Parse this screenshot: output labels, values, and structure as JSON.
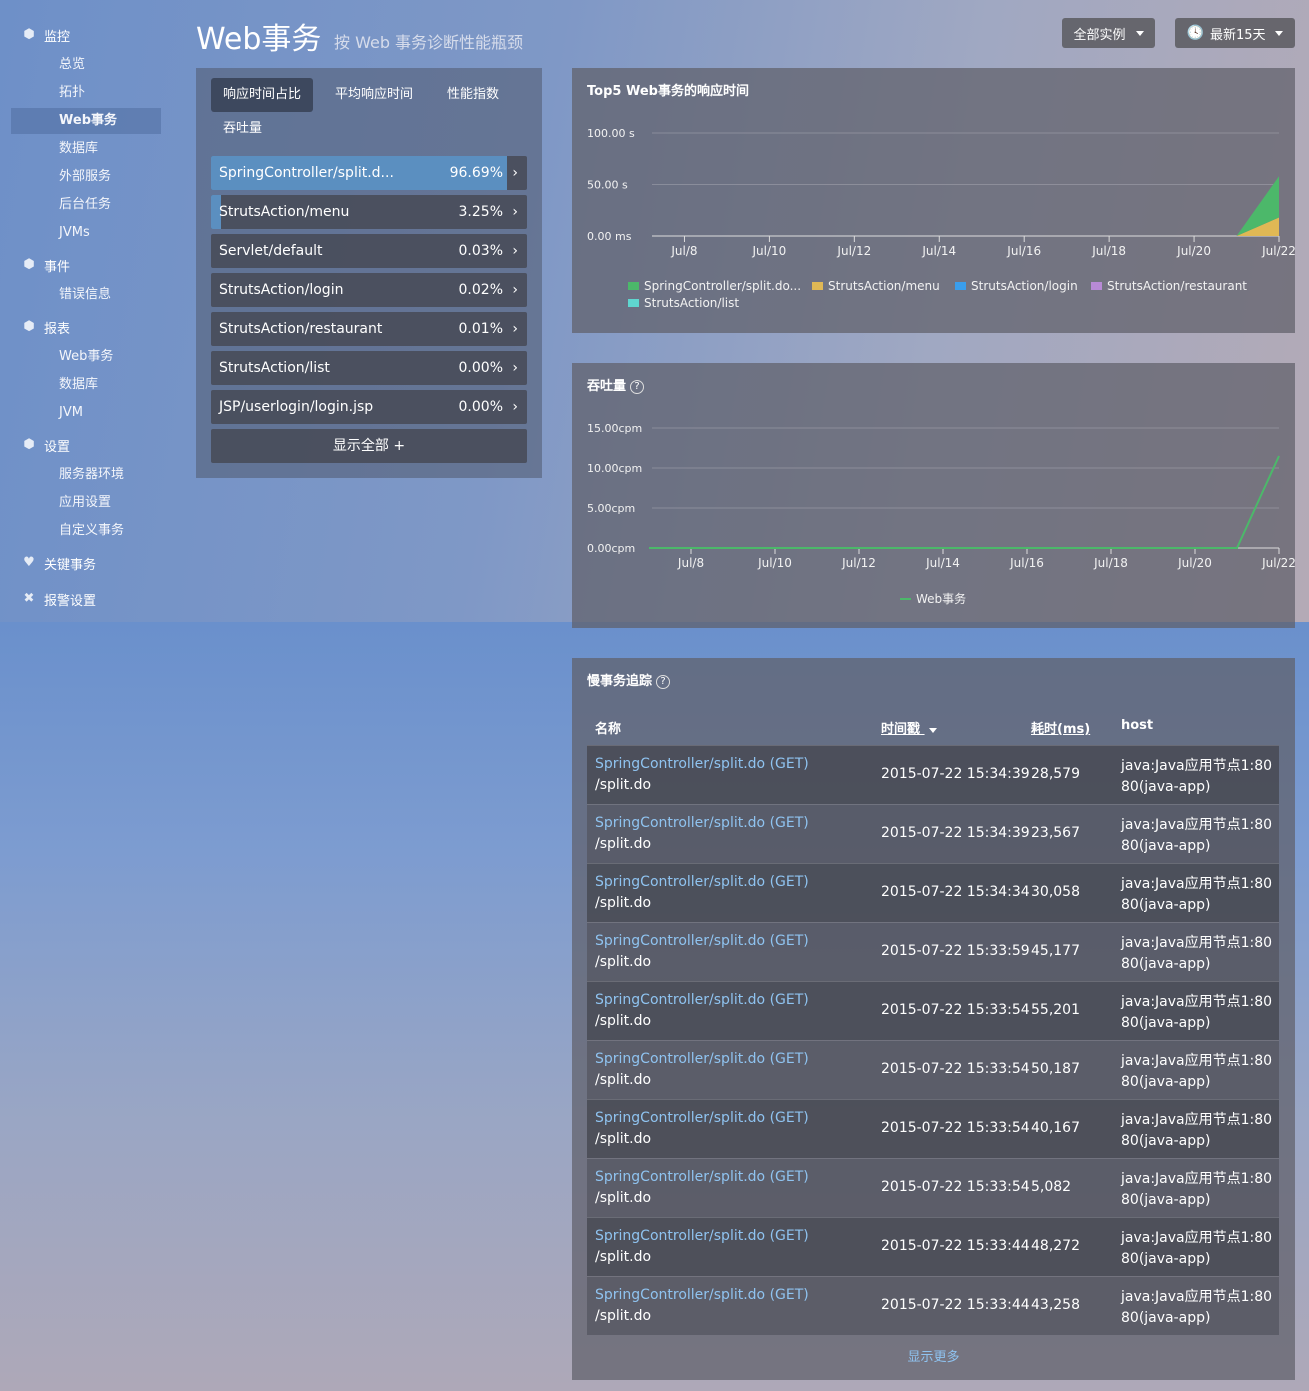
{
  "sidebar": {
    "monitor": {
      "label": "监控",
      "icon": "cube-icon",
      "items": [
        "总览",
        "拓扑",
        "Web事务",
        "数据库",
        "外部服务",
        "后台任务",
        "JVMs"
      ]
    },
    "events": {
      "label": "事件",
      "icon": "cube-icon",
      "items": [
        "错误信息"
      ]
    },
    "reports": {
      "label": "报表",
      "icon": "cube-icon",
      "items": [
        "Web事务",
        "数据库",
        "JVM"
      ]
    },
    "settings": {
      "label": "设置",
      "icon": "cube-icon",
      "items": [
        "服务器环境",
        "应用设置",
        "自定义事务"
      ]
    },
    "key_tx": {
      "label": "关键事务",
      "icon": "heart-icon"
    },
    "alerts": {
      "label": "报警设置",
      "icon": "tools-icon"
    }
  },
  "header": {
    "title": "Web事务",
    "subtitle": "按 Web 事务诊断性能瓶颈",
    "instances": "全部实例",
    "range": "最新15天"
  },
  "left_panel": {
    "tabs": [
      "响应时间占比",
      "平均响应时间",
      "性能指数",
      "吞吐量"
    ],
    "rows": [
      {
        "name": "SpringController/split.d...",
        "pct": "96.69%",
        "frac": 0.9669
      },
      {
        "name": "StrutsAction/menu",
        "pct": "3.25%",
        "frac": 0.0325
      },
      {
        "name": "Servlet/default",
        "pct": "0.03%",
        "frac": 0.0003
      },
      {
        "name": "StrutsAction/login",
        "pct": "0.02%",
        "frac": 0.0002
      },
      {
        "name": "StrutsAction/restaurant",
        "pct": "0.01%",
        "frac": 0.0001
      },
      {
        "name": "StrutsAction/list",
        "pct": "0.00%",
        "frac": 0
      },
      {
        "name": "JSP/userlogin/login.jsp",
        "pct": "0.00%",
        "frac": 0
      }
    ],
    "show_all": "显示全部 +"
  },
  "chart1": {
    "title": "Top5 Web事务的响应时间"
  },
  "chart2": {
    "title": "吞吐量"
  },
  "chart_data": [
    {
      "type": "area",
      "title": "Top5 Web事务的响应时间",
      "x_ticks": [
        "Jul/8",
        "Jul/10",
        "Jul/12",
        "Jul/14",
        "Jul/16",
        "Jul/18",
        "Jul/20",
        "Jul/22"
      ],
      "y_ticks": [
        "100.00 s",
        "50.00 s",
        "0.00 ms"
      ],
      "ylim": [
        0,
        100
      ],
      "x": [
        "Jul/7",
        "Jul/8",
        "Jul/9",
        "Jul/10",
        "Jul/11",
        "Jul/12",
        "Jul/13",
        "Jul/14",
        "Jul/15",
        "Jul/16",
        "Jul/17",
        "Jul/18",
        "Jul/19",
        "Jul/20",
        "Jul/21",
        "Jul/22"
      ],
      "series": [
        {
          "name": "SpringController/split.do...",
          "color": "#4cb86a",
          "values": [
            0,
            0,
            0,
            0,
            0,
            0,
            0,
            0,
            0,
            0,
            0,
            0,
            0,
            0,
            0,
            40
          ]
        },
        {
          "name": "StrutsAction/menu",
          "color": "#e0b855",
          "values": [
            0,
            0,
            0,
            0,
            0,
            0,
            0,
            0,
            0,
            0,
            0,
            0,
            0,
            0,
            0,
            18
          ]
        },
        {
          "name": "StrutsAction/login",
          "color": "#3a9eec",
          "values": [
            0,
            0,
            0,
            0,
            0,
            0,
            0,
            0,
            0,
            0,
            0,
            0,
            0,
            0,
            0,
            0
          ]
        },
        {
          "name": "StrutsAction/restaurant",
          "color": "#b88ad6",
          "values": [
            0,
            0,
            0,
            0,
            0,
            0,
            0,
            0,
            0,
            0,
            0,
            0,
            0,
            0,
            0,
            0
          ]
        },
        {
          "name": "StrutsAction/list",
          "color": "#5fd6d0",
          "values": [
            0,
            0,
            0,
            0,
            0,
            0,
            0,
            0,
            0,
            0,
            0,
            0,
            0,
            0,
            0,
            0
          ]
        }
      ],
      "legend": "bottom"
    },
    {
      "type": "line",
      "title": "吞吐量",
      "x_ticks": [
        "Jul/8",
        "Jul/10",
        "Jul/12",
        "Jul/14",
        "Jul/16",
        "Jul/18",
        "Jul/20",
        "Jul/22"
      ],
      "y_ticks": [
        "15.00cpm",
        "10.00cpm",
        "5.00cpm",
        "0.00cpm"
      ],
      "ylim": [
        0,
        15
      ],
      "x": [
        "Jul/7",
        "Jul/8",
        "Jul/9",
        "Jul/10",
        "Jul/11",
        "Jul/12",
        "Jul/13",
        "Jul/14",
        "Jul/15",
        "Jul/16",
        "Jul/17",
        "Jul/18",
        "Jul/19",
        "Jul/20",
        "Jul/21",
        "Jul/22"
      ],
      "series": [
        {
          "name": "Web事务",
          "color": "#4cb86a",
          "values": [
            0,
            0,
            0,
            0,
            0,
            0,
            0,
            0,
            0,
            0,
            0,
            0,
            0,
            0,
            0,
            11.5
          ]
        }
      ],
      "legend": "bottom"
    }
  ],
  "slow": {
    "title": "慢事务追踪",
    "headers": [
      "名称",
      "时间戳",
      "耗时(ms)",
      "host"
    ],
    "rows": [
      {
        "name": "SpringController/split.do (GET)",
        "path": "/split.do",
        "time": "2015-07-22 15:34:39",
        "ms": "28,579",
        "host": "java:Java应用节点1:8080(java-app)"
      },
      {
        "name": "SpringController/split.do (GET)",
        "path": "/split.do",
        "time": "2015-07-22 15:34:39",
        "ms": "23,567",
        "host": "java:Java应用节点1:8080(java-app)"
      },
      {
        "name": "SpringController/split.do (GET)",
        "path": "/split.do",
        "time": "2015-07-22 15:34:34",
        "ms": "30,058",
        "host": "java:Java应用节点1:8080(java-app)"
      },
      {
        "name": "SpringController/split.do (GET)",
        "path": "/split.do",
        "time": "2015-07-22 15:33:59",
        "ms": "45,177",
        "host": "java:Java应用节点1:8080(java-app)"
      },
      {
        "name": "SpringController/split.do (GET)",
        "path": "/split.do",
        "time": "2015-07-22 15:33:54",
        "ms": "55,201",
        "host": "java:Java应用节点1:8080(java-app)"
      },
      {
        "name": "SpringController/split.do (GET)",
        "path": "/split.do",
        "time": "2015-07-22 15:33:54",
        "ms": "50,187",
        "host": "java:Java应用节点1:8080(java-app)"
      },
      {
        "name": "SpringController/split.do (GET)",
        "path": "/split.do",
        "time": "2015-07-22 15:33:54",
        "ms": "40,167",
        "host": "java:Java应用节点1:8080(java-app)"
      },
      {
        "name": "SpringController/split.do (GET)",
        "path": "/split.do",
        "time": "2015-07-22 15:33:54",
        "ms": "5,082",
        "host": "java:Java应用节点1:8080(java-app)"
      },
      {
        "name": "SpringController/split.do (GET)",
        "path": "/split.do",
        "time": "2015-07-22 15:33:44",
        "ms": "48,272",
        "host": "java:Java应用节点1:8080(java-app)"
      },
      {
        "name": "SpringController/split.do (GET)",
        "path": "/split.do",
        "time": "2015-07-22 15:33:44",
        "ms": "43,258",
        "host": "java:Java应用节点1:8080(java-app)"
      }
    ],
    "more": "显示更多"
  }
}
